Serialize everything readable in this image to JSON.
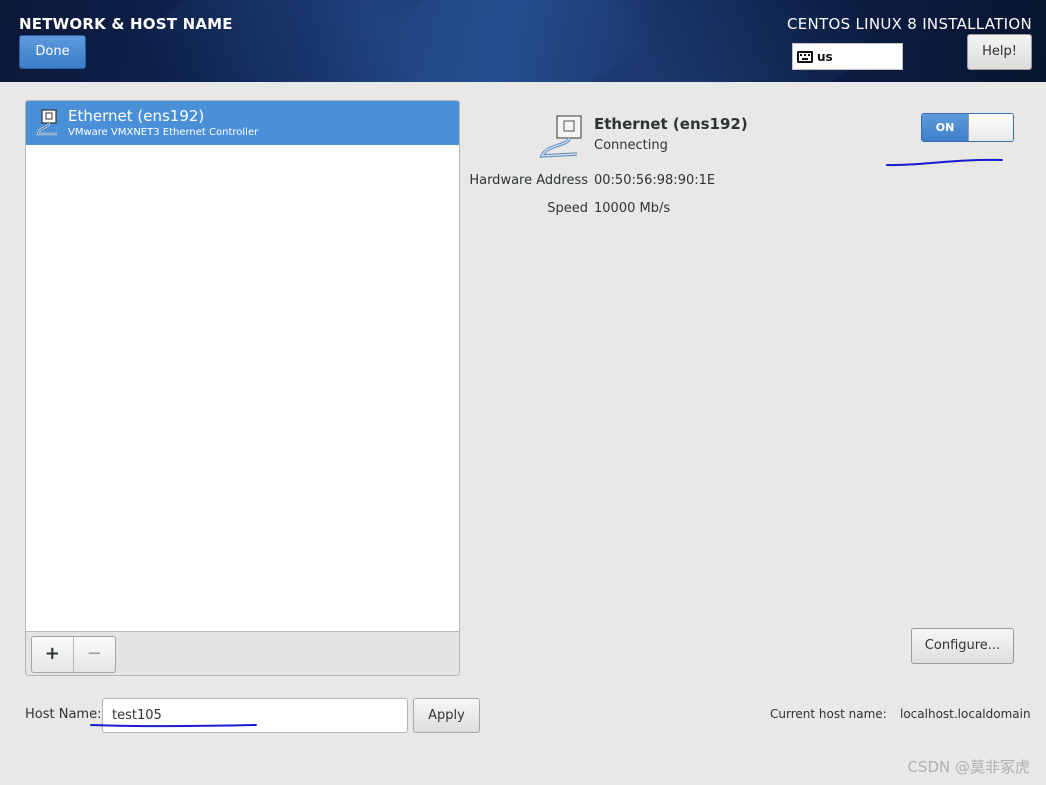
{
  "header": {
    "spoke_title": "NETWORK & HOST NAME",
    "done_label": "Done",
    "product_title": "CENTOS LINUX 8 INSTALLATION",
    "keyboard_layout": "us",
    "help_label": "Help!"
  },
  "device_list": {
    "items": [
      {
        "name": "Ethernet (ens192)",
        "description": "VMware VMXNET3 Ethernet Controller",
        "selected": true
      }
    ],
    "add_label": "+",
    "remove_label": "−"
  },
  "device_detail": {
    "name": "Ethernet (ens192)",
    "status": "Connecting",
    "properties": [
      {
        "label": "Hardware Address",
        "value": "00:50:56:98:90:1E"
      },
      {
        "label": "Speed",
        "value": "10000 Mb/s"
      }
    ],
    "switch_label": "ON",
    "switch_on": true,
    "configure_label": "Configure..."
  },
  "hostname": {
    "label": "Host Name:",
    "value": "test105",
    "apply_label": "Apply",
    "current_label": "Current host name:",
    "current_value": "localhost.localdomain"
  },
  "watermark": "CSDN @莫非冢虎",
  "icons": {
    "device": "ethernet-cable-icon",
    "keyboard": "keyboard-icon"
  },
  "colors": {
    "accent": "#4a90d9",
    "header_bg": "#0e2350",
    "annotation": "#1a1ad0"
  }
}
